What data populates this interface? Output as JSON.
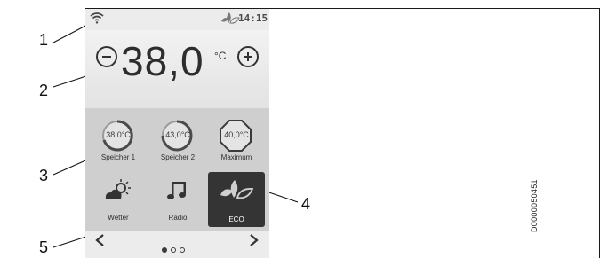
{
  "status_bar": {
    "time": "14:15",
    "wifi_icon": "wifi-icon",
    "leaf_icon": "eco-leaves-icon"
  },
  "temperature": {
    "value": "38,0",
    "unit": "°C",
    "minus_icon": "minus-circle-icon",
    "plus_icon": "plus-circle-icon"
  },
  "tiles": [
    {
      "label": "Speicher 1",
      "gauge": "38,0°C",
      "icon": "gauge-icon"
    },
    {
      "label": "Speicher 2",
      "gauge": "43,0°C",
      "icon": "gauge-icon"
    },
    {
      "label": "Maximum",
      "gauge": "40,0°C",
      "icon": "octagon-gauge-icon"
    },
    {
      "label": "Wetter",
      "icon": "weather-icon"
    },
    {
      "label": "Radio",
      "icon": "music-note-icon"
    },
    {
      "label": "ECO",
      "icon": "eco-leaves-icon",
      "active": true
    }
  ],
  "navigation": {
    "prev_icon": "chevron-left-icon",
    "next_icon": "chevron-right-icon",
    "page_dots": 3,
    "active_dot": 1
  },
  "callouts": [
    "1",
    "2",
    "3",
    "4",
    "5"
  ],
  "figure_code": "D0000050451"
}
